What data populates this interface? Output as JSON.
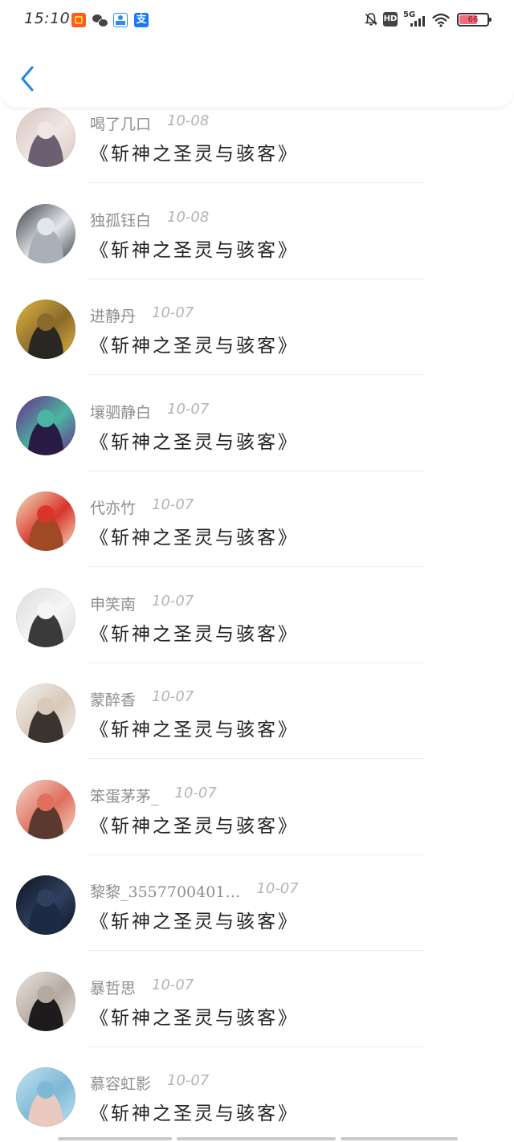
{
  "status_bar": {
    "time": "15:10",
    "network": "5G",
    "hd_label": "HD",
    "battery_level": "66",
    "battery_fraction": 0.66,
    "battery_color": "#f26b7a",
    "app_icons": [
      "taobao-icon",
      "wechat-icon",
      "map-icon",
      "alipay-icon"
    ],
    "alipay_glyph": "支"
  },
  "nav": {
    "back_icon": "chevron-left-icon",
    "accent": "#1e88e5"
  },
  "comments": [
    {
      "user": "喝了几口",
      "date": "10-08",
      "book": "《斩神之圣灵与骇客》",
      "avatar_colors": [
        "#d8c7c0",
        "#6d5f72",
        "#f0e6e4"
      ]
    },
    {
      "user": "独孤钰白",
      "date": "10-08",
      "book": "《斩神之圣灵与骇客》",
      "avatar_colors": [
        "#3b4048",
        "#aab0b8",
        "#e3e6ea"
      ]
    },
    {
      "user": "进静丹",
      "date": "10-07",
      "book": "《斩神之圣灵与骇客》",
      "avatar_colors": [
        "#e0b640",
        "#2a2622",
        "#8a6a2a"
      ]
    },
    {
      "user": "壤驷静白",
      "date": "10-07",
      "book": "《斩神之圣灵与骇客》",
      "avatar_colors": [
        "#6a2c8c",
        "#2a1b44",
        "#4ab5a0"
      ]
    },
    {
      "user": "代亦竹",
      "date": "10-07",
      "book": "《斩神之圣灵与骇客》",
      "avatar_colors": [
        "#f3e2bf",
        "#a04a25",
        "#d9352b"
      ]
    },
    {
      "user": "申笑南",
      "date": "10-07",
      "book": "《斩神之圣灵与骇客》",
      "avatar_colors": [
        "#dcdde0",
        "#3a3a3a",
        "#f5f5f5"
      ]
    },
    {
      "user": "蒙醉香",
      "date": "10-07",
      "book": "《斩神之圣灵与骇客》",
      "avatar_colors": [
        "#f2f2f0",
        "#3b3330",
        "#d9c9b8"
      ]
    },
    {
      "user": "笨蛋茅茅_",
      "date": "10-07",
      "book": "《斩神之圣灵与骇客》",
      "avatar_colors": [
        "#f3d9cc",
        "#5a3a2e",
        "#e06f5f"
      ]
    },
    {
      "user": "黎黎_3557700401…",
      "date": "10-07",
      "book": "《斩神之圣灵与骇客》",
      "avatar_colors": [
        "#0e1424",
        "#1d2a44",
        "#2f3f5e"
      ]
    },
    {
      "user": "暴哲思",
      "date": "10-07",
      "book": "《斩神之圣灵与骇客》",
      "avatar_colors": [
        "#e8e4e0",
        "#1d1b1b",
        "#b5aaa0"
      ]
    },
    {
      "user": "慕容虹影",
      "date": "10-07",
      "book": "《斩神之圣灵与骇客》",
      "avatar_colors": [
        "#bfe3f2",
        "#e9c9c0",
        "#7fb8d6"
      ]
    }
  ]
}
